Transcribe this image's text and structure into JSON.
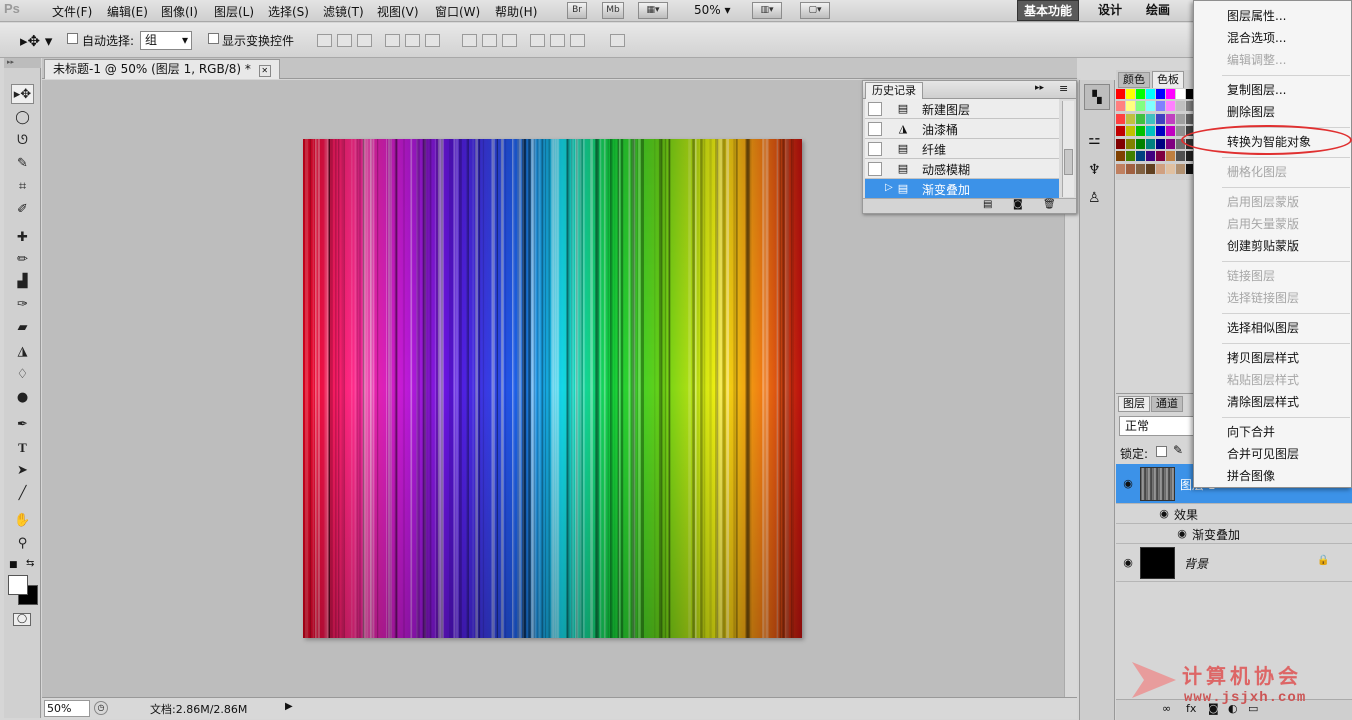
{
  "app": {
    "logo": "Ps"
  },
  "menubar": {
    "items": [
      "文件(F)",
      "编辑(E)",
      "图像(I)",
      "图层(L)",
      "选择(S)",
      "滤镜(T)",
      "视图(V)",
      "窗口(W)",
      "帮助(H)"
    ],
    "bridge_label": "Br",
    "minibridge_label": "Mb",
    "zoom": "50%",
    "workspaces": [
      "基本功能",
      "设计",
      "绘画"
    ]
  },
  "options": {
    "auto_select_label": "自动选择:",
    "auto_select_value": "组",
    "show_transform_label": "显示变换控件"
  },
  "document": {
    "tab_title": "未标题-1 @ 50% (图层 1, RGB/8) *",
    "close_glyph": "✕"
  },
  "status": {
    "zoom": "50%",
    "doc_info": "文档:2.86M/2.86M"
  },
  "history": {
    "title": "历史记录",
    "items": [
      {
        "label": "新建图层",
        "icon": "document-icon",
        "selected": false
      },
      {
        "label": "油漆桶",
        "icon": "paint-bucket-icon",
        "selected": false
      },
      {
        "label": "纤维",
        "icon": "document-icon",
        "selected": false
      },
      {
        "label": "动感模糊",
        "icon": "document-icon",
        "selected": false
      },
      {
        "label": "渐变叠加",
        "icon": "document-icon",
        "selected": true
      }
    ]
  },
  "color_panel": {
    "tabs": [
      "颜色",
      "色板"
    ],
    "swatches": [
      "#ff0000",
      "#ffff00",
      "#00ff00",
      "#00ffff",
      "#0000ff",
      "#ff00ff",
      "#ffffff",
      "#000000",
      "#ff8080",
      "#ffff80",
      "#80ff80",
      "#80ffff",
      "#8080ff",
      "#ff80ff",
      "#c0c0c0",
      "#808080",
      "#ff4040",
      "#c0c040",
      "#40c040",
      "#40c0c0",
      "#4040c0",
      "#c040c0",
      "#a0a0a0",
      "#606060",
      "#c00000",
      "#c0c000",
      "#00c000",
      "#00c0c0",
      "#0000c0",
      "#c000c0",
      "#909090",
      "#404040",
      "#800000",
      "#808000",
      "#008000",
      "#008080",
      "#000080",
      "#800080",
      "#707070",
      "#303030",
      "#804000",
      "#408000",
      "#004080",
      "#400080",
      "#800040",
      "#c08040",
      "#505050",
      "#202020",
      "#c08060",
      "#a06040",
      "#806040",
      "#604020",
      "#d0a080",
      "#e0c0a0",
      "#b09070",
      "#101010"
    ]
  },
  "layers": {
    "tabs": [
      "图层",
      "通道"
    ],
    "blend_mode": "正常",
    "lock_label": "锁定:",
    "layer1_name": "图层 1",
    "effects_label": "效果",
    "effect_name": "渐变叠加",
    "background_name": "背景"
  },
  "context_menu": {
    "items": [
      {
        "label": "图层属性...",
        "disabled": false,
        "sep_after": false
      },
      {
        "label": "混合选项...",
        "disabled": false,
        "sep_after": false
      },
      {
        "label": "编辑调整...",
        "disabled": true,
        "sep_after": true
      },
      {
        "label": "复制图层...",
        "disabled": false,
        "sep_after": false
      },
      {
        "label": "删除图层",
        "disabled": false,
        "sep_after": true
      },
      {
        "label": "转换为智能对象",
        "disabled": false,
        "sep_after": true
      },
      {
        "label": "栅格化图层",
        "disabled": true,
        "sep_after": true
      },
      {
        "label": "启用图层蒙版",
        "disabled": true,
        "sep_after": false
      },
      {
        "label": "启用矢量蒙版",
        "disabled": true,
        "sep_after": false
      },
      {
        "label": "创建剪贴蒙版",
        "disabled": false,
        "sep_after": true
      },
      {
        "label": "链接图层",
        "disabled": true,
        "sep_after": false
      },
      {
        "label": "选择链接图层",
        "disabled": true,
        "sep_after": true
      },
      {
        "label": "选择相似图层",
        "disabled": false,
        "sep_after": true
      },
      {
        "label": "拷贝图层样式",
        "disabled": false,
        "sep_after": false
      },
      {
        "label": "粘贴图层样式",
        "disabled": true,
        "sep_after": false
      },
      {
        "label": "清除图层样式",
        "disabled": false,
        "sep_after": true
      },
      {
        "label": "向下合并",
        "disabled": false,
        "sep_after": false
      },
      {
        "label": "合并可见图层",
        "disabled": false,
        "sep_after": false
      },
      {
        "label": "拼合图像",
        "disabled": false,
        "sep_after": false
      }
    ]
  },
  "watermark": {
    "text": "计算机协会",
    "url": "www.jsjxh.com"
  }
}
